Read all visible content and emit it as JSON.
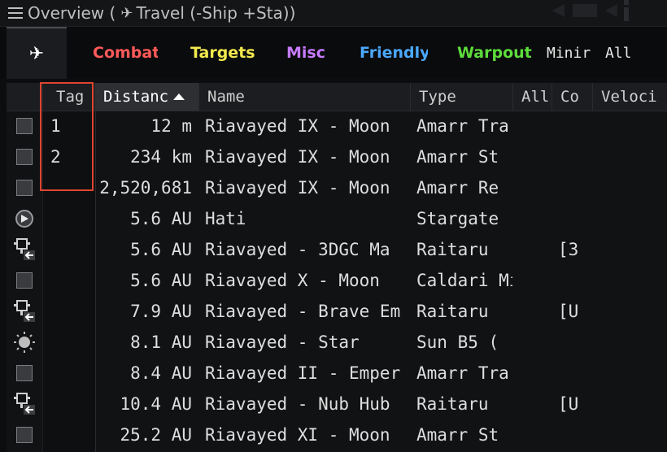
{
  "window": {
    "title": "Overview",
    "preset": "Travel (-Ship +Sta))",
    "title_sep": " (",
    "plane_glyph": "✈"
  },
  "tabs": [
    {
      "label": "✈",
      "color": "#ffffff",
      "active": true
    },
    {
      "label": "Combat",
      "color": "#ff5a5a"
    },
    {
      "label": "Targets",
      "color": "#f2e94e"
    },
    {
      "label": "Misc",
      "color": "#c77bff"
    },
    {
      "label": "Friendly",
      "color": "#4aa8ff"
    },
    {
      "label": "Warpout",
      "color": "#5ddc3c"
    },
    {
      "label": "Minir",
      "color": "#e8e8e8"
    },
    {
      "label": "All",
      "color": "#e8e8e8"
    }
  ],
  "columns": [
    "Tag",
    "Distanc",
    "Name",
    "Type",
    "All",
    "Co",
    "Veloci"
  ],
  "sorted_column": "Distanc",
  "rows": [
    {
      "icon": "checkbox-icon",
      "tag": "1",
      "distance": "12 m",
      "name": "Riavayed IX - Moon",
      "type": "Amarr Tra",
      "co": ""
    },
    {
      "icon": "checkbox-icon",
      "tag": "2",
      "distance": "234 km",
      "name": "Riavayed IX - Moon",
      "type": "Amarr St",
      "co": ""
    },
    {
      "icon": "checkbox-icon",
      "tag": "",
      "distance": "2,520,681",
      "name": "Riavayed IX - Moon",
      "type": "Amarr Re",
      "co": ""
    },
    {
      "icon": "stargate-icon",
      "tag": "",
      "distance": "5.6 AU",
      "name": "Hati",
      "type": "Stargate",
      "co": ""
    },
    {
      "icon": "structure-icon",
      "tag": "",
      "distance": "5.6 AU",
      "name": "Riavayed - 3DGC Ma",
      "type": "Raitaru",
      "co": "[3"
    },
    {
      "icon": "checkbox-icon",
      "tag": "",
      "distance": "5.6 AU",
      "name": "Riavayed X - Moon",
      "type": "Caldari Mi",
      "co": ""
    },
    {
      "icon": "structure-icon",
      "tag": "",
      "distance": "7.9 AU",
      "name": "Riavayed - Brave Em",
      "type": "Raitaru",
      "co": "[U"
    },
    {
      "icon": "sun-icon",
      "tag": "",
      "distance": "8.1 AU",
      "name": "Riavayed - Star",
      "type": "Sun B5 (",
      "co": ""
    },
    {
      "icon": "checkbox-icon",
      "tag": "",
      "distance": "8.4 AU",
      "name": "Riavayed II - Emper",
      "type": "Amarr Tra",
      "co": ""
    },
    {
      "icon": "structure-icon",
      "tag": "",
      "distance": "10.4 AU",
      "name": "Riavayed - Nub Hub",
      "type": "Raitaru",
      "co": "[U"
    },
    {
      "icon": "checkbox-icon",
      "tag": "",
      "distance": "25.2 AU",
      "name": "Riavayed XI - Moon",
      "type": "Amarr St",
      "co": ""
    }
  ],
  "highlight_color": "#e0452f"
}
